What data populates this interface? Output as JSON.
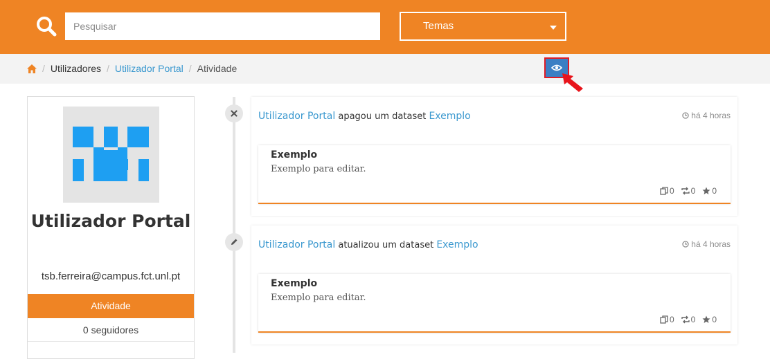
{
  "header": {
    "search_placeholder": "Pesquisar",
    "themes_label": "Temas",
    "accent_color": "#ef8424",
    "icons": {
      "search": "search-icon",
      "dropdown": "caret-down-icon",
      "view": "eye-icon",
      "home": "home-icon"
    }
  },
  "breadcrumb": {
    "items": [
      "Utilizadores",
      "Utilizador Portal",
      "Atividade"
    ]
  },
  "profile": {
    "name": "Utilizador Portal",
    "email": "tsb.ferreira@campus.fct.unl.pt",
    "tab_active": "Atividade",
    "followers": "0 seguidores"
  },
  "activities": [
    {
      "icon": "close-icon",
      "user": "Utilizador Portal",
      "action": "apagou um dataset",
      "target": "Exemplo",
      "time": "há 4 horas",
      "dataset": {
        "title": "Exemplo",
        "description": "Exemplo para editar.",
        "stats": [
          "0",
          "0",
          "0"
        ]
      }
    },
    {
      "icon": "pencil-icon",
      "user": "Utilizador Portal",
      "action": "atualizou um dataset",
      "target": "Exemplo",
      "time": "há 4 horas",
      "dataset": {
        "title": "Exemplo",
        "description": "Exemplo para editar.",
        "stats": [
          "0",
          "0",
          "0"
        ]
      }
    }
  ]
}
